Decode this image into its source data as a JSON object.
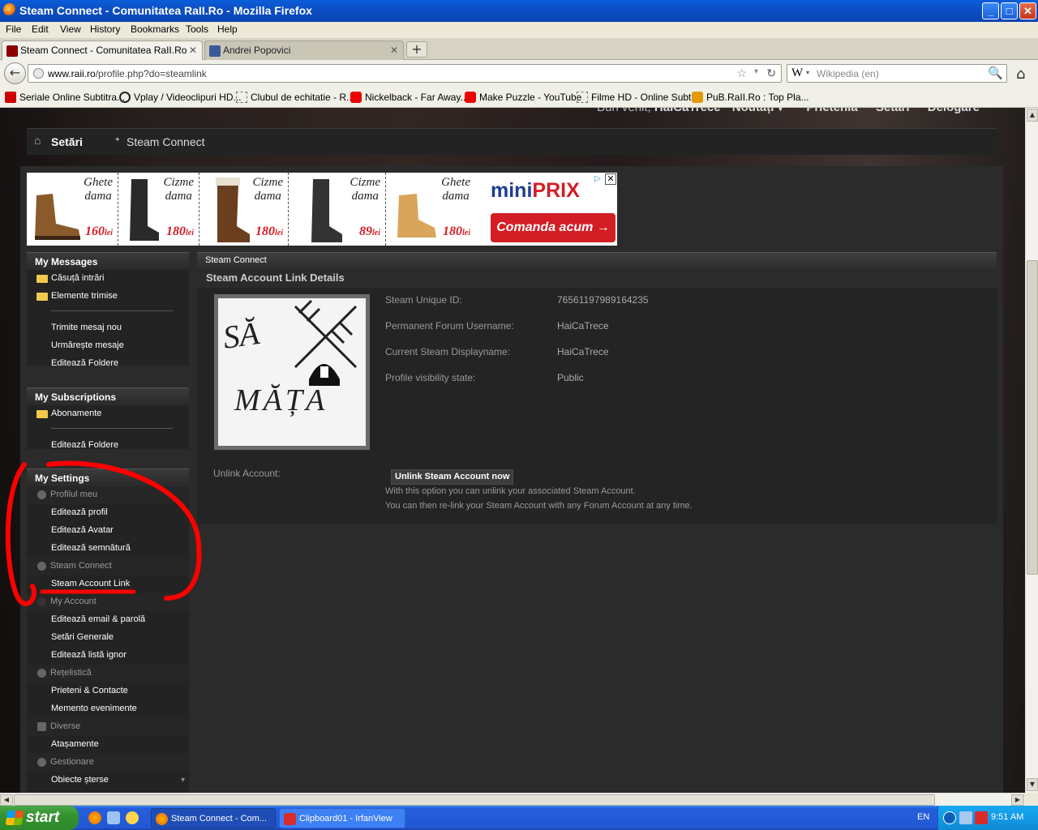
{
  "window": {
    "title": "Steam Connect - Comunitatea RaII.Ro - Mozilla Firefox",
    "min": "_",
    "max": "□",
    "close": "✕"
  },
  "menu": [
    "File",
    "Edit",
    "View",
    "History",
    "Bookmarks",
    "Tools",
    "Help"
  ],
  "tabs": [
    {
      "label": "Steam Connect - Comunitatea RaII.Ro",
      "close": "✕"
    },
    {
      "label": "Andrei Popovici",
      "close": "✕"
    }
  ],
  "new_tab": "+",
  "nav": {
    "back": "←",
    "url_host": "www.raii.ro",
    "url_path": "/profile.php?do=steamlink",
    "star": "☆",
    "dropdown": "▾",
    "reload": "↻",
    "search_engine": "W",
    "search_placeholder": "Wikipedia (en)",
    "search_icon": "🔍",
    "home": "⌂"
  },
  "bookmarks": [
    "Seriale Online Subtitra...",
    "Vplay / Videoclipuri HD...",
    "Clubul de echitatie - R...",
    "Nickelback - Far Away...",
    "Make Puzzle - YouTube",
    "Filme HD - Online Subt...",
    "PuB.RaII.Ro : Top Pla..."
  ],
  "topnav": {
    "welcome": "Bun venit,",
    "user": "HaiCaTrece",
    "items": [
      "Noutăți ▾",
      "Prietenia",
      "Setări",
      "Delogare"
    ]
  },
  "breadcrumb": {
    "home_icon": "⌂",
    "sep": "✦",
    "items": [
      "Setări",
      "Steam Connect"
    ]
  },
  "ad": {
    "shoes": [
      {
        "label": "Ghete\ndama",
        "price": "160",
        "unit": "lei"
      },
      {
        "label": "Cizme\ndama",
        "price": "180",
        "unit": "lei"
      },
      {
        "label": "Cizme\ndama",
        "price": "180",
        "unit": "lei"
      },
      {
        "label": "Cizme\ndama",
        "price": "89",
        "unit": "lei"
      },
      {
        "label": "Ghete\ndama",
        "price": "180",
        "unit": "lei"
      }
    ],
    "brand_a": "mini",
    "brand_b": "PRIX",
    "cta": "Comanda acum →",
    "close": "✕",
    "info": "▷"
  },
  "sidebar": {
    "messages": {
      "title": "My Messages",
      "folders": [
        "Căsuță intrări",
        "Elemente trimise"
      ],
      "links": [
        "Trimite mesaj nou",
        "Urmărește mesaje",
        "Editează Foldere"
      ]
    },
    "subscriptions": {
      "title": "My Subscriptions",
      "folders": [
        "Abonamente"
      ],
      "links": [
        "Editează Foldere"
      ]
    },
    "settings": {
      "title": "My Settings",
      "groups": [
        {
          "cat": "Profilul meu",
          "links": [
            "Editează profil",
            "Editează Avatar",
            "Editează semnătură"
          ]
        },
        {
          "cat": "Steam Connect",
          "links": [
            "Steam Account Link"
          ]
        },
        {
          "cat": "My Account",
          "links": [
            "Editează email & parolă",
            "Setări Generale",
            "Editează listă ignor"
          ]
        },
        {
          "cat": "Rețelistică",
          "links": [
            "Prieteni & Contacte",
            "Memento evenimente"
          ]
        },
        {
          "cat": "Diverse",
          "links": [
            "Atașamente"
          ]
        },
        {
          "cat": "Gestionare",
          "links": [
            "Obiecte șterse"
          ]
        }
      ],
      "more": "▾"
    }
  },
  "panel": {
    "header": "Steam Connect",
    "title": "Steam Account Link Details",
    "avatar_text_top": "SĂ",
    "avatar_text_bottom": "MĂȚA",
    "fields": [
      {
        "label": "Steam Unique ID:",
        "value": "76561197989164235"
      },
      {
        "label": "Permanent Forum Username:",
        "value": "HaiCaTrece"
      },
      {
        "label": "Current Steam Displayname:",
        "value": "HaiCaTrece"
      },
      {
        "label": "Profile visibility state:",
        "value": "Public"
      }
    ],
    "unlink_label": "Unlink Account:",
    "unlink_button": "Unlink Steam Account now",
    "unlink_desc1": "With this option you can unlink your associated Steam Account.",
    "unlink_desc2": "You can then re-link your Steam Account with any Forum Account at any time."
  },
  "scroll": {
    "up": "▲",
    "down": "▼",
    "left": "◀",
    "right": "▶"
  },
  "taskbar": {
    "start": "start",
    "items": [
      "Steam Connect - Com...",
      "Clipboard01 - IrfanView"
    ],
    "lang": "EN",
    "clock": "9:51 AM"
  },
  "colors": {
    "accent_red": "#d31d25",
    "annotation": "#ff0000",
    "panel_bg": "#2b2b2b",
    "xp_blue": "#245edb"
  }
}
